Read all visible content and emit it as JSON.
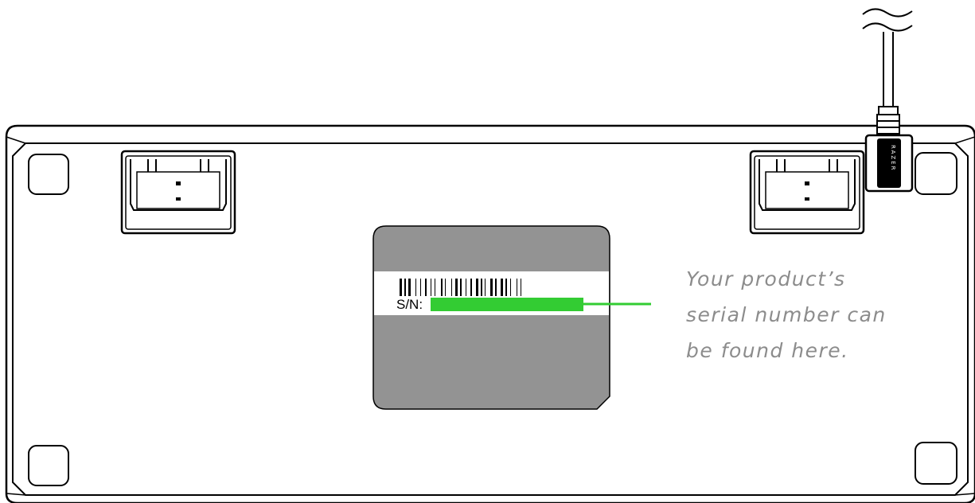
{
  "label": {
    "sn_prefix": "S/N:",
    "highlight_color": "#33cc33"
  },
  "callout": {
    "lines": [
      "Your product’s",
      "serial number can",
      "be found here."
    ],
    "color": "#8c8c8c"
  },
  "cable_brand": "RAZER",
  "colors": {
    "outline": "#000000",
    "label_plate": "#939393",
    "accent": "#33cc33"
  }
}
